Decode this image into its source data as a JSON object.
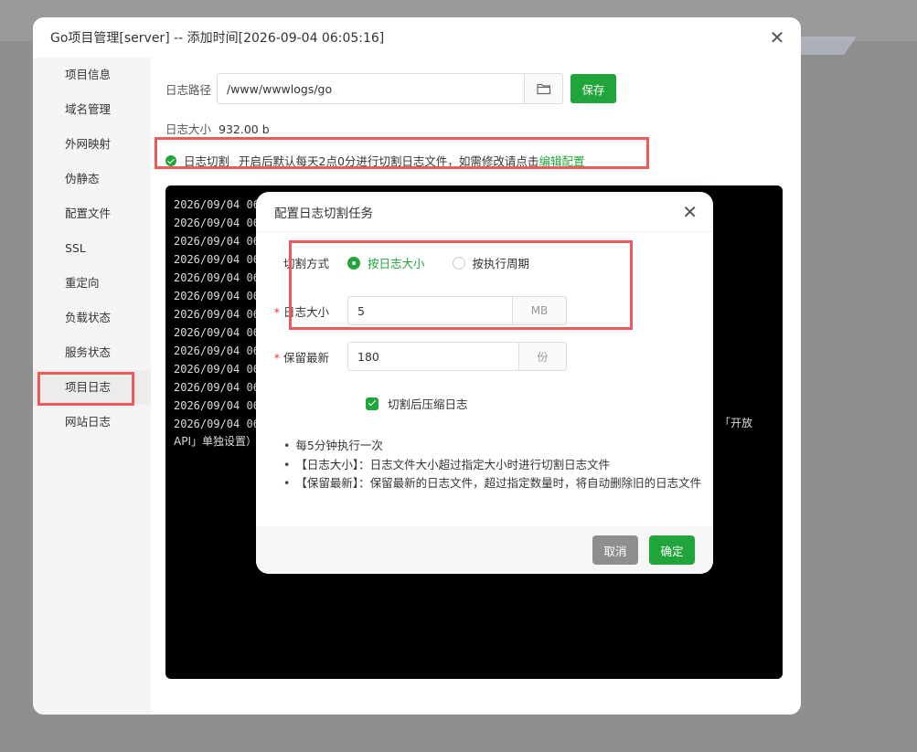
{
  "main": {
    "title": "Go项目管理[server] -- 添加时间[2026-09-04 06:05:16]",
    "close_icon": "close-icon"
  },
  "sidebar": {
    "items": [
      {
        "label": "项目信息"
      },
      {
        "label": "域名管理"
      },
      {
        "label": "外网映射"
      },
      {
        "label": "伪静态"
      },
      {
        "label": "配置文件"
      },
      {
        "label": "SSL"
      },
      {
        "label": "重定向"
      },
      {
        "label": "负载状态"
      },
      {
        "label": "服务状态"
      },
      {
        "label": "项目日志",
        "active": true
      },
      {
        "label": "网站日志"
      }
    ]
  },
  "log_settings": {
    "path_label": "日志路径",
    "path_value": "/www/wwwlogs/go",
    "save_label": "保存",
    "size_label": "日志大小",
    "size_value": "932.00 b",
    "split_label": "日志切割",
    "split_desc": "开启后默认每天2点0分进行切割日志文件，如需修改请点击",
    "split_link": "编辑配置"
  },
  "log_lines": [
    "2026/09/04 06",
    "2026/09/04 06",
    "2026/09/04 06",
    "2026/09/04 06",
    "2026/09/04 06",
    "2026/09/04 06",
    "2026/09/04 06",
    "2026/09/04 06",
    "2026/09/04 06",
    "2026/09/04 06",
    "2026/09/04 06",
    "2026/09/04 06",
    "2026/09/04 06"
  ],
  "log_tail": "API」单独设置）",
  "log_tail_right": "「开放",
  "dialog": {
    "title": "配置日志切割任务",
    "method_label": "切割方式",
    "method_options": [
      "按日志大小",
      "按执行周期"
    ],
    "method_selected": "按日志大小",
    "size_label": "日志大小",
    "size_value": "5",
    "size_unit": "MB",
    "keep_label": "保留最新",
    "keep_value": "180",
    "keep_unit": "份",
    "compress_label": "切割后压缩日志",
    "notes": [
      "每5分钟执行一次",
      "【日志大小】：日志文件大小超过指定大小时进行切割日志文件",
      "【保留最新】：保留最新的日志文件，超过指定数量时，将自动删除旧的日志文件"
    ],
    "cancel_label": "取消",
    "ok_label": "确定"
  },
  "colors": {
    "accent": "#20a53a",
    "highlight": "#ee5a5a"
  }
}
